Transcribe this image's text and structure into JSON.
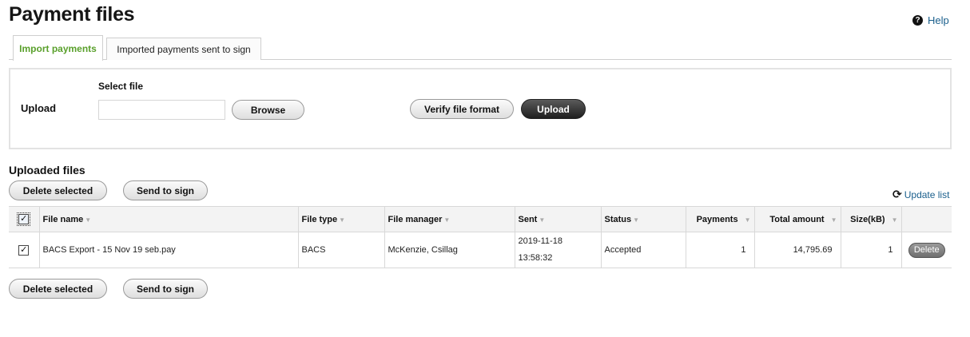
{
  "page": {
    "title": "Payment files",
    "help_label": "Help"
  },
  "tabs": [
    {
      "label": "Import payments",
      "active": true
    },
    {
      "label": "Imported payments sent to sign",
      "active": false
    }
  ],
  "upload": {
    "label": "Upload",
    "select_file_label": "Select file",
    "file_value": "",
    "browse_label": "Browse",
    "verify_label": "Verify file format",
    "upload_label": "Upload"
  },
  "uploaded": {
    "title": "Uploaded files",
    "delete_selected_label": "Delete selected",
    "send_to_sign_label": "Send to sign",
    "update_list_label": "Update list"
  },
  "table": {
    "columns": [
      "File name",
      "File type",
      "File manager",
      "Sent",
      "Status",
      "Payments",
      "Total amount",
      "Size(kB)"
    ],
    "header_checked": true,
    "rows": [
      {
        "checked": true,
        "file_name": "BACS Export - 15 Nov 19 seb.pay",
        "file_type": "BACS",
        "file_manager": "McKenzie, Csillag",
        "sent_date": "2019-11-18",
        "sent_time": "13:58:32",
        "status": "Accepted",
        "payments": "1",
        "total_amount": "14,795.69",
        "size_kb": "1",
        "delete_label": "Delete"
      }
    ]
  },
  "colors": {
    "active_tab": "#5aa02c",
    "link": "#1a5f8c",
    "dark_button": "#2a2a2a"
  },
  "icons": {
    "help": "question-circle-icon",
    "refresh": "refresh-icon",
    "sort": "sort-down-icon",
    "checkbox": "checkmark-icon"
  }
}
